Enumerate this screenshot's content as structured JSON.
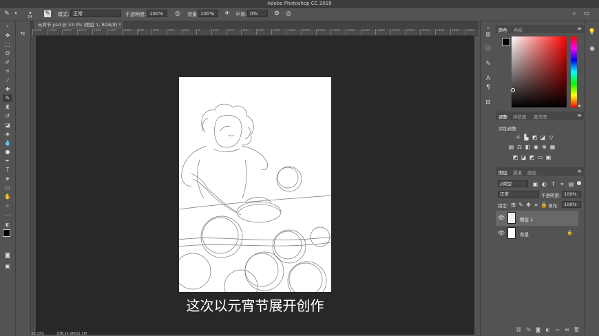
{
  "app": {
    "title": "Adobe Photoshop CC 2018"
  },
  "options_bar": {
    "brush_size": "24",
    "mode_label": "模式:",
    "mode_value": "正常",
    "opacity_label": "不透明度:",
    "opacity_value": "100%",
    "flow_label": "流量:",
    "flow_value": "100%",
    "smoothing_label": "平滑:",
    "smoothing_value": "0%"
  },
  "document": {
    "tab_label": "元宵节.psd @ 33.3% (图层 1, RGB/8) *",
    "subtitle": "这次以元宵节展开创作",
    "zoom_status": "33.33%",
    "doc_status": "文档:24.9M/31.5M"
  },
  "ruler": {
    "ticks": [
      "2200",
      "2000",
      "1800",
      "1600",
      "1400",
      "1200",
      "1000",
      "800",
      "600",
      "400",
      "200",
      "0",
      "200",
      "400",
      "600",
      "800",
      "1000",
      "1200",
      "1400",
      "1600",
      "1800",
      "2000",
      "2200",
      "2400",
      "2600",
      "2800",
      "3000",
      "3200",
      "3400",
      "3600"
    ]
  },
  "color_panel": {
    "tabs": [
      "颜色",
      "色板"
    ],
    "active_tab": 0
  },
  "adjust_panel": {
    "tabs": [
      "调整",
      "导航器",
      "直方图"
    ],
    "add_label": "添加调整"
  },
  "layers_panel": {
    "tabs": [
      "图层",
      "通道",
      "路径"
    ],
    "filter_label": "ρ类型",
    "blend_mode": "正常",
    "opacity_label": "不透明度:",
    "opacity_value": "100%",
    "lock_label": "锁定:",
    "fill_label": "填充:",
    "fill_value": "100%",
    "layers": [
      {
        "name": "图层 1",
        "selected": true,
        "locked": false
      },
      {
        "name": "背景",
        "selected": false,
        "locked": true
      }
    ]
  },
  "colors": {
    "accent_red": "#ff0000",
    "canvas_bg": "#282828",
    "ui_bg": "#535353"
  }
}
